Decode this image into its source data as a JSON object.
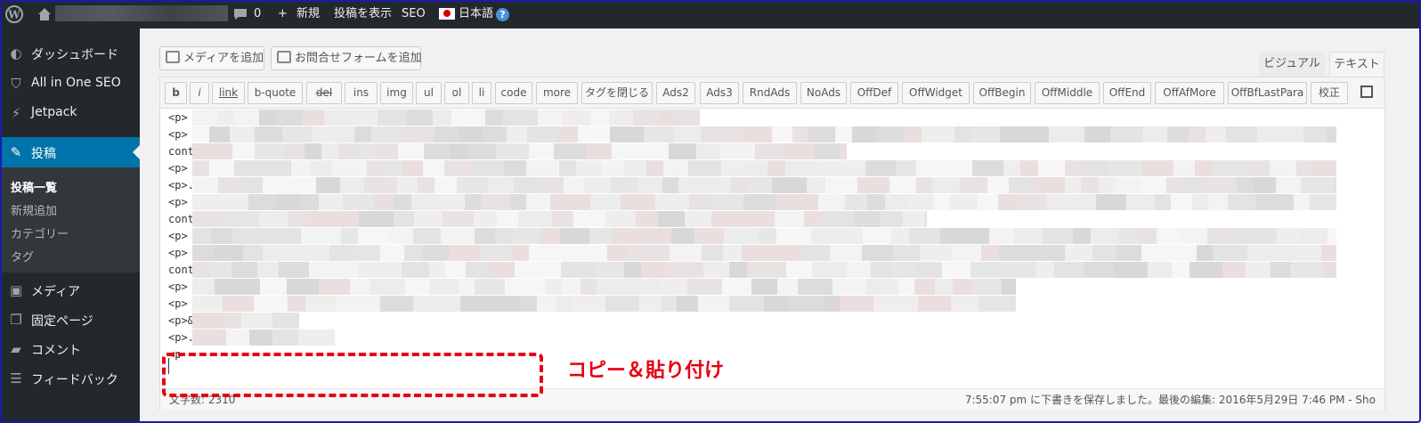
{
  "adminbar": {
    "wp_logo": "wordpress-icon",
    "home_icon": "home-icon",
    "comment_count": "0",
    "new_label": "新規",
    "view_post": "投稿を表示",
    "seo": "SEO",
    "language": "日本語",
    "help_glyph": "?"
  },
  "sidebar": {
    "items": [
      {
        "label": "ダッシュボード",
        "icon": "dashboard-icon",
        "glyph": "◐"
      },
      {
        "label": "All in One SEO",
        "icon": "shield-icon",
        "glyph": "⛉"
      },
      {
        "label": "Jetpack",
        "icon": "jetpack-icon",
        "glyph": "⚡"
      },
      {
        "label": "投稿",
        "icon": "pin-icon",
        "glyph": "✎"
      },
      {
        "label": "メディア",
        "icon": "media-icon",
        "glyph": "▣"
      },
      {
        "label": "固定ページ",
        "icon": "page-icon",
        "glyph": "❐"
      },
      {
        "label": "コメント",
        "icon": "comment-icon",
        "glyph": "▰"
      },
      {
        "label": "フィードバック",
        "icon": "feedback-icon",
        "glyph": "☰"
      }
    ],
    "submenu": [
      "投稿一覧",
      "新規追加",
      "カテゴリー",
      "タグ"
    ]
  },
  "editor": {
    "media_button": "メディアを追加",
    "form_button": "お問合せフォームを追加",
    "tab_visual": "ビジュアル",
    "tab_text": "テキスト",
    "quicktags": [
      "b",
      "i",
      "link",
      "b-quote",
      "del",
      "ins",
      "img",
      "ul",
      "ol",
      "li",
      "code",
      "more",
      "タグを閉じる",
      "Ads2",
      "Ads3",
      "RndAds",
      "NoAds",
      "OffDef",
      "OffWidget",
      "OffBegin",
      "OffMiddle",
      "OffEnd",
      "OffAfMore",
      "OffBfLastPara",
      "校正"
    ],
    "lines": [
      "<p>",
      "<p>",
      "cont",
      "<p>",
      "<p>.",
      "<p>",
      "cont",
      "<p>",
      "<p>",
      "cont",
      "<p>",
      "<p>",
      "<p>&",
      "<p>.",
      "<p"
    ],
    "word_count": "文字数: 2310",
    "autosave": "7:55:07 pm に下書きを保存しました。最後の編集: 2016年5月29日 7:46 PM - Sho"
  },
  "annotation": "コピー＆貼り付け"
}
